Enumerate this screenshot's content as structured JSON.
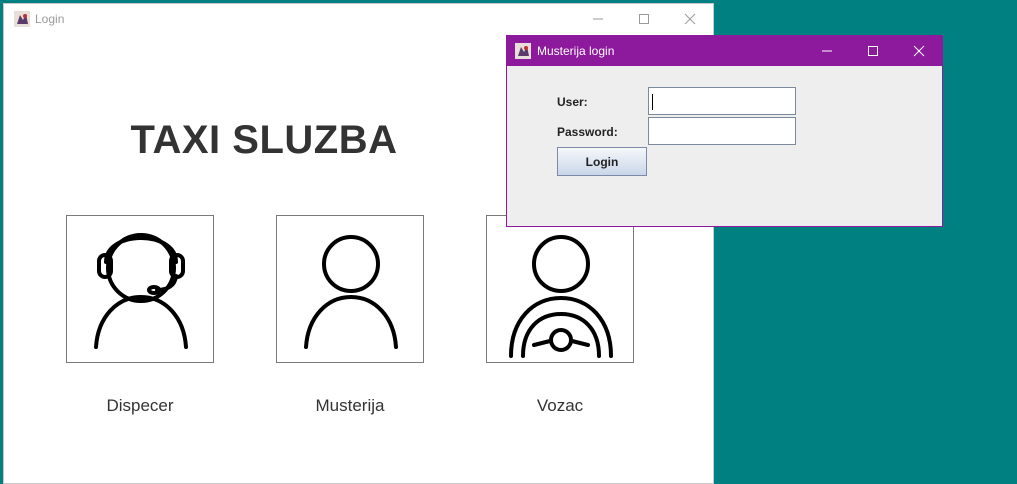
{
  "main_window": {
    "title": "Login",
    "heading": "TAXI SLUZBA",
    "roles": [
      {
        "label": "Dispecer",
        "icon": "dispatcher-headset-icon"
      },
      {
        "label": "Musterija",
        "icon": "customer-person-icon"
      },
      {
        "label": "Vozac",
        "icon": "driver-steering-wheel-icon"
      }
    ]
  },
  "dialog": {
    "title": "Musterija login",
    "user_label": "User:",
    "user_value": "",
    "password_label": "Password:",
    "password_value": "",
    "login_button": "Login"
  },
  "colors": {
    "desktop": "#008080",
    "dialog_titlebar": "#8d1a9c"
  }
}
